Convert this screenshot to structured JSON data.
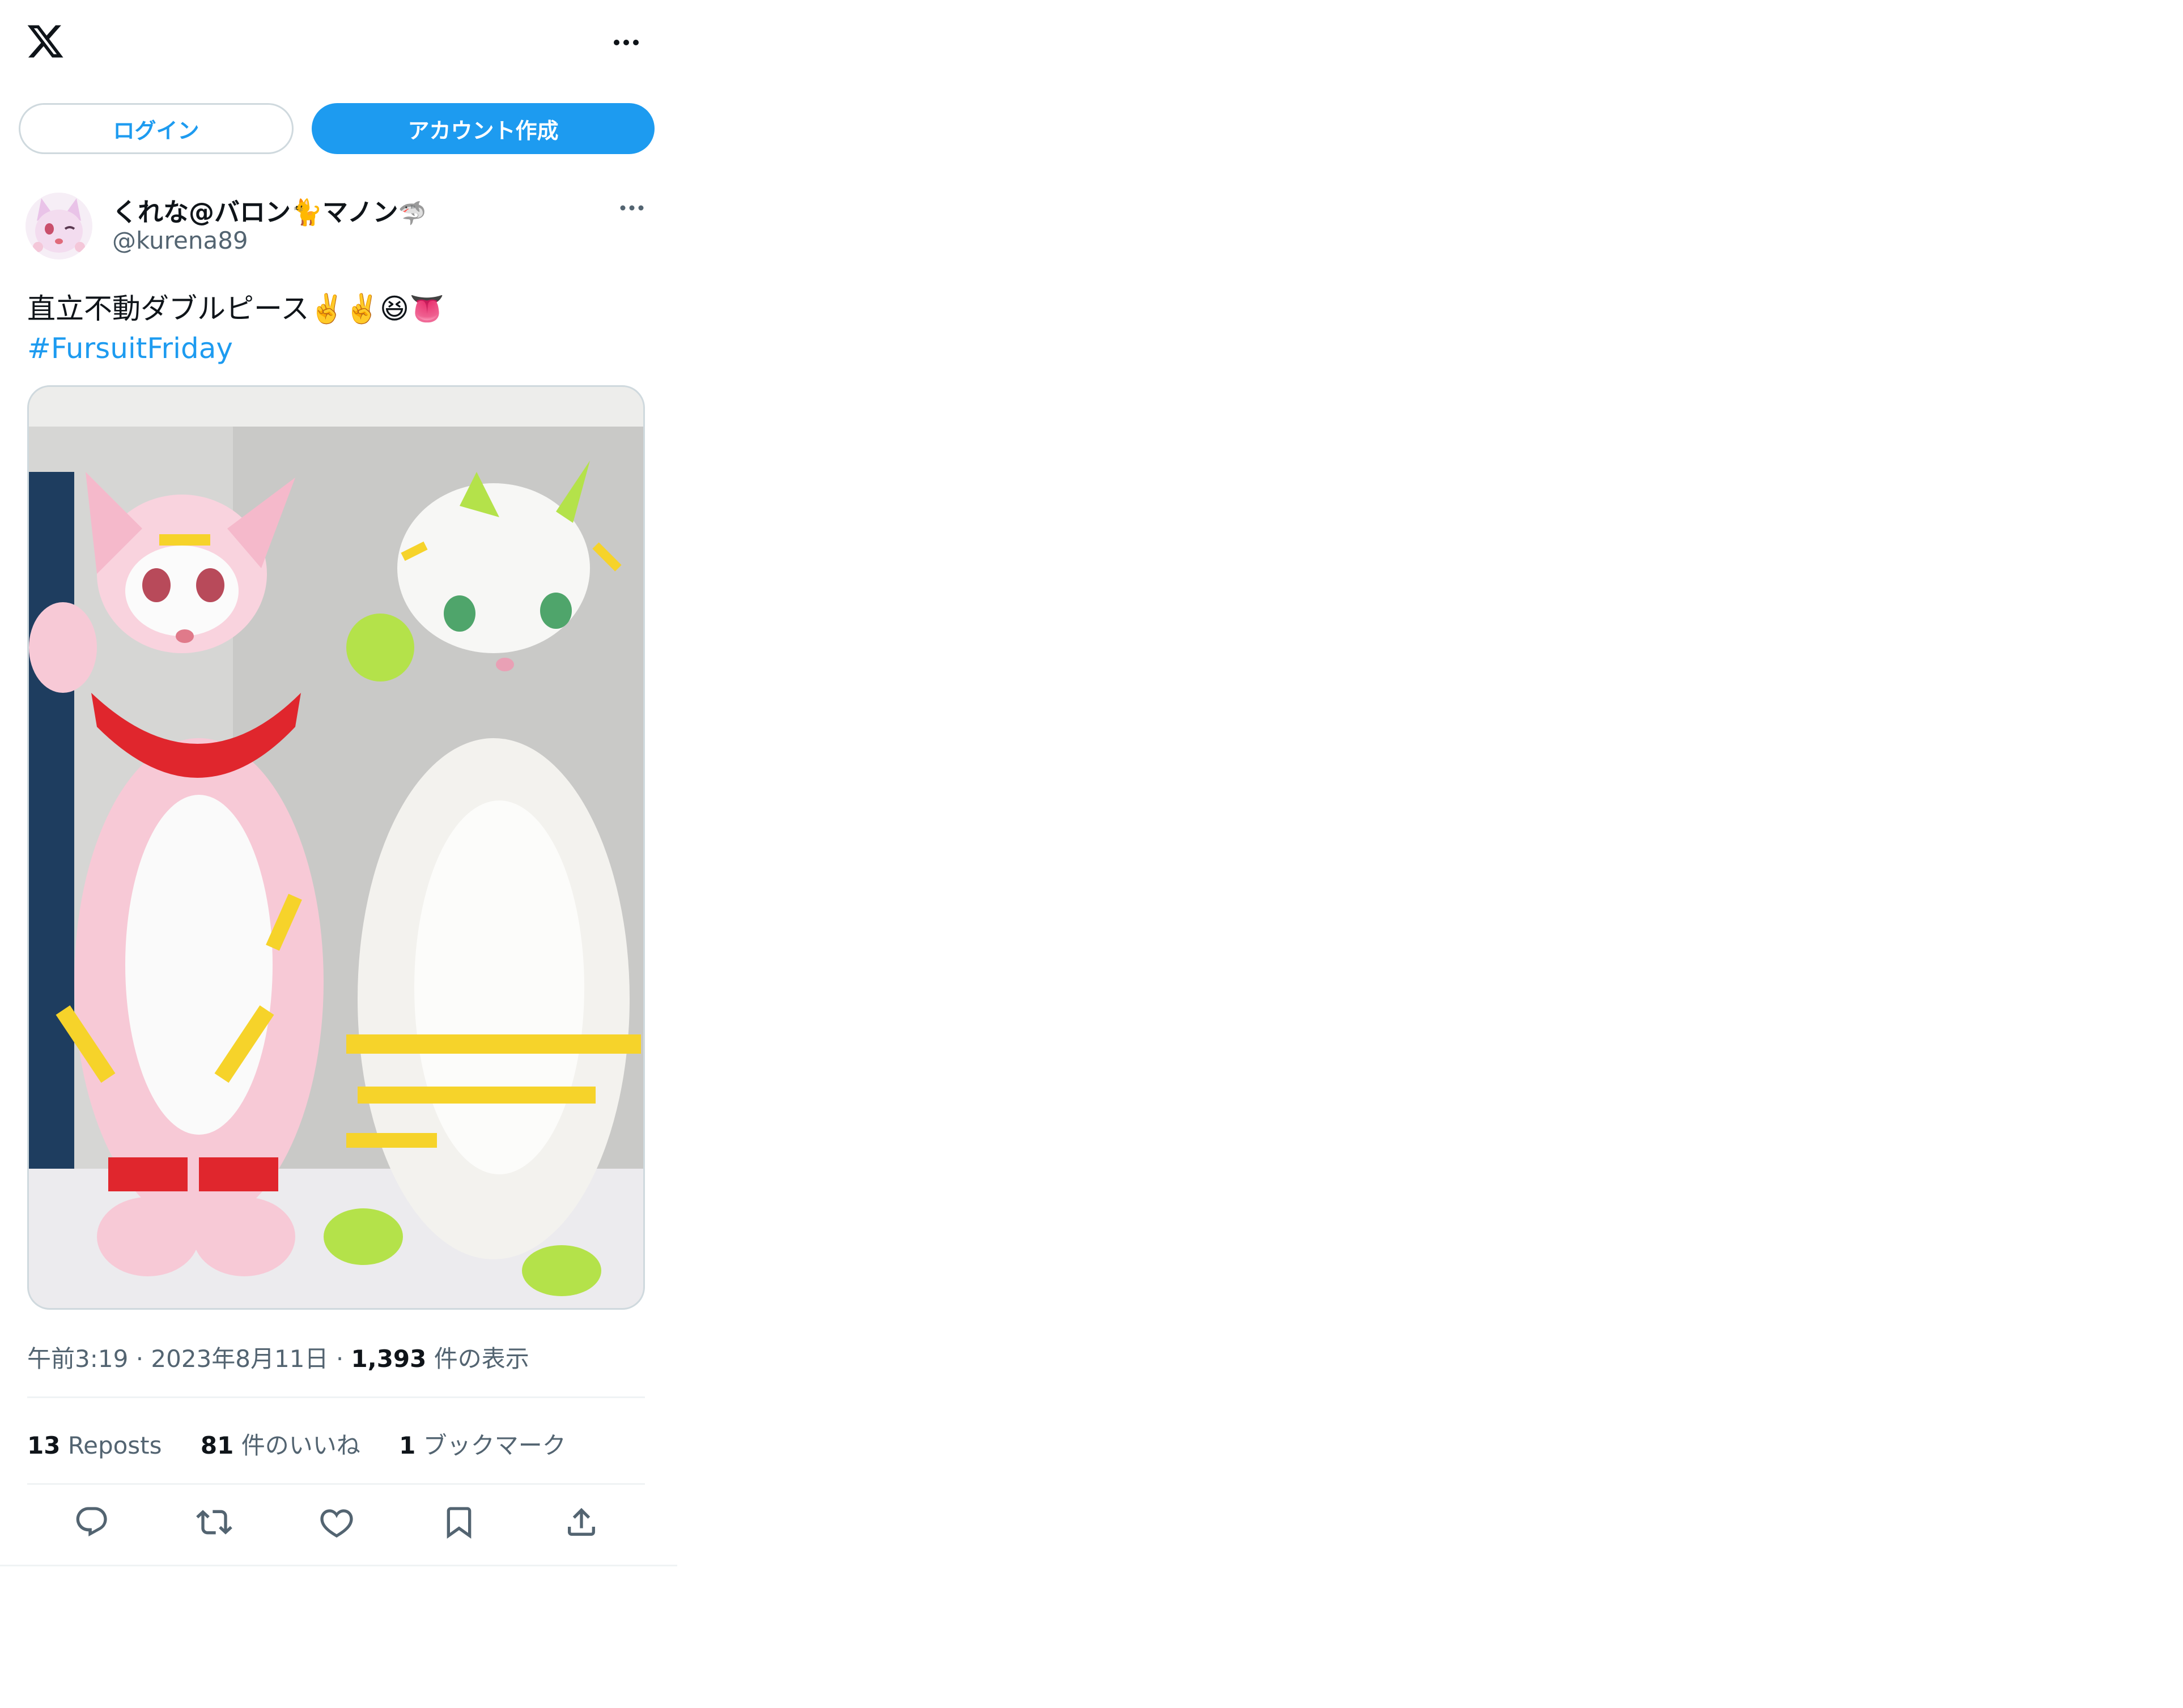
{
  "header": {
    "logo_icon": "x-logo-icon",
    "more_icon": "more-horizontal-icon"
  },
  "auth": {
    "login_label": "ログイン",
    "signup_label": "アカウント作成"
  },
  "tweet": {
    "author_name": "くれな@バロン🐈マノン",
    "author_name_emoji": "🦈",
    "handle": "@kurena89",
    "text": "直立不動ダブルピース✌️✌️😆👅",
    "hashtag": "#FursuitFriday",
    "time": "午前3:19",
    "date": "2023年8月11日",
    "views_count": "1,393",
    "views_label": "件の表示",
    "reposts_count": "13",
    "reposts_label": "Reposts",
    "likes_count": "81",
    "likes_label": "件のいいね",
    "bookmarks_count": "1",
    "bookmarks_label": "ブックマーク"
  },
  "colors": {
    "accent": "#1d9bf0",
    "text_primary": "#0f1419",
    "text_secondary": "#536471",
    "border": "#cfd9de"
  },
  "actions": [
    "reply-icon",
    "repost-icon",
    "like-icon",
    "bookmark-icon",
    "share-icon"
  ]
}
